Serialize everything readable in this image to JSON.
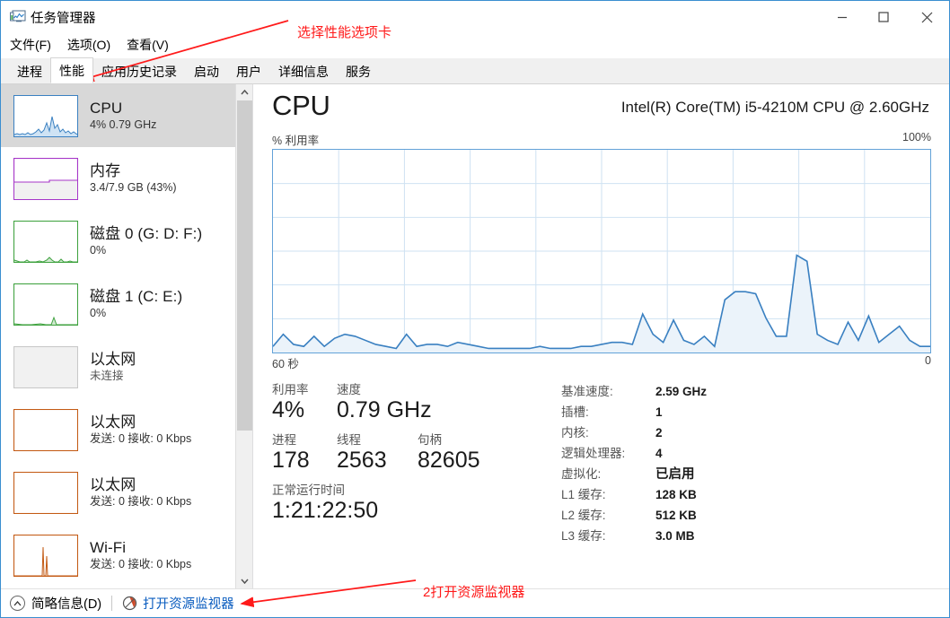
{
  "window": {
    "title": "任务管理器",
    "icon": "taskmanager-icon",
    "minimize_label": "—",
    "maximize_label": "☐",
    "close_label": "✕"
  },
  "menu": {
    "items": [
      {
        "label": "文件(F)"
      },
      {
        "label": "选项(O)"
      },
      {
        "label": "查看(V)"
      }
    ]
  },
  "tabs": {
    "items": [
      {
        "label": "进程",
        "active": false
      },
      {
        "label": "性能",
        "active": true
      },
      {
        "label": "应用历史记录",
        "active": false
      },
      {
        "label": "启动",
        "active": false
      },
      {
        "label": "用户",
        "active": false
      },
      {
        "label": "详细信息",
        "active": false
      },
      {
        "label": "服务",
        "active": false
      }
    ]
  },
  "sidebar": {
    "items": [
      {
        "title": "CPU",
        "sub": "4% 0.79 GHz",
        "color": "#3a80c1",
        "selected": true
      },
      {
        "title": "内存",
        "sub": "3.4/7.9 GB (43%)",
        "color": "#a636c8",
        "selected": false
      },
      {
        "title": "磁盘 0 (G: D: F:)",
        "sub": "0%",
        "color": "#3fa23f",
        "selected": false
      },
      {
        "title": "磁盘 1 (C: E:)",
        "sub": "0%",
        "color": "#3fa23f",
        "selected": false
      },
      {
        "title": "以太网",
        "sub": "未连接",
        "color": "#c8c8c8",
        "selected": false
      },
      {
        "title": "以太网",
        "sub": "发送: 0 接收: 0 Kbps",
        "color": "#c35a14",
        "selected": false
      },
      {
        "title": "以太网",
        "sub": "发送: 0 接收: 0 Kbps",
        "color": "#c35a14",
        "selected": false
      },
      {
        "title": "Wi-Fi",
        "sub": "发送: 0 接收: 0 Kbps",
        "color": "#c35a14",
        "selected": false
      }
    ],
    "scroll_up_icon": "chevron-up-icon",
    "scroll_down_icon": "chevron-down-icon"
  },
  "panel": {
    "title": "CPU",
    "model": "Intel(R) Core(TM) i5-4210M CPU @ 2.60GHz",
    "axis_y_label": "% 利用率",
    "axis_y_max": "100%",
    "axis_x_left": "60 秒",
    "axis_x_right": "0",
    "stats": {
      "row1": [
        {
          "label": "利用率",
          "value": "4%"
        },
        {
          "label": "速度",
          "value": "0.79 GHz"
        }
      ],
      "row2": [
        {
          "label": "进程",
          "value": "178"
        },
        {
          "label": "线程",
          "value": "2563"
        },
        {
          "label": "句柄",
          "value": "82605"
        }
      ],
      "row3": [
        {
          "label": "正常运行时间",
          "value": "1:21:22:50"
        }
      ]
    },
    "specs": [
      {
        "key": "基准速度:",
        "value": "2.59 GHz"
      },
      {
        "key": "插槽:",
        "value": "1"
      },
      {
        "key": "内核:",
        "value": "2"
      },
      {
        "key": "逻辑处理器:",
        "value": "4"
      },
      {
        "key": "虚拟化:",
        "value": "已启用"
      },
      {
        "key": "L1 缓存:",
        "value": "128 KB"
      },
      {
        "key": "L2 缓存:",
        "value": "512 KB"
      },
      {
        "key": "L3 缓存:",
        "value": "3.0 MB"
      }
    ]
  },
  "statusbar": {
    "fewer_details": "简略信息(D)",
    "fewer_icon": "chevron-up-circle-icon",
    "resource_monitor": "打开资源监视器",
    "resource_monitor_icon": "resource-monitor-icon"
  },
  "annotations": [
    {
      "text": "选择性能选项卡",
      "color": "#ff1a1a"
    },
    {
      "text": "2打开资源监视器",
      "color": "#ff1a1a"
    }
  ],
  "chart_data": {
    "type": "area",
    "title": "CPU % 利用率",
    "xlabel": "60 秒",
    "ylabel": "% 利用率",
    "ylim": [
      0,
      100
    ],
    "xlim": [
      60,
      0
    ],
    "grid": true,
    "grid_cols": 10,
    "grid_rows": 6,
    "line_color": "#3a80c1",
    "fill_color": "#eaf2fa",
    "values": [
      3,
      9,
      4,
      3,
      8,
      3,
      7,
      9,
      8,
      6,
      4,
      3,
      2,
      9,
      3,
      4,
      4,
      3,
      5,
      4,
      3,
      2,
      2,
      2,
      2,
      2,
      3,
      2,
      2,
      2,
      3,
      3,
      4,
      5,
      5,
      4,
      19,
      9,
      5,
      16,
      6,
      4,
      8,
      3,
      26,
      30,
      30,
      29,
      17,
      8,
      8,
      48,
      45,
      9,
      6,
      4,
      15,
      6,
      18,
      5,
      9,
      13,
      6,
      3,
      3
    ]
  }
}
